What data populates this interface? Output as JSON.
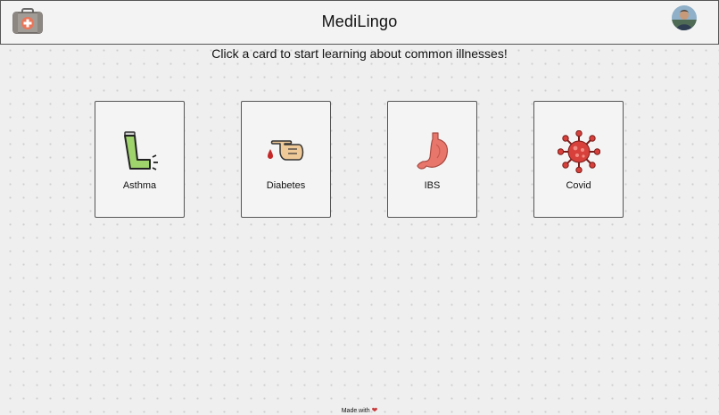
{
  "header": {
    "title": "MediLingo",
    "logo_icon": "first-aid-kit-icon",
    "avatar_icon": "user-avatar"
  },
  "main": {
    "instruction": "Click a card to start learning about common illnesses!",
    "cards": [
      {
        "label": "Asthma",
        "icon": "inhaler-icon"
      },
      {
        "label": "Diabetes",
        "icon": "finger-blood-drop-icon"
      },
      {
        "label": "IBS",
        "icon": "stomach-icon"
      },
      {
        "label": "Covid",
        "icon": "virus-icon"
      }
    ]
  },
  "footer": {
    "text": "Made with",
    "icon": "heart-icon"
  },
  "colors": {
    "background": "#efefef",
    "border": "#555555",
    "inhaler_green": "#9fd36b",
    "stomach": "#e9766b",
    "virus": "#d7403b",
    "heart": "#c7393a"
  }
}
